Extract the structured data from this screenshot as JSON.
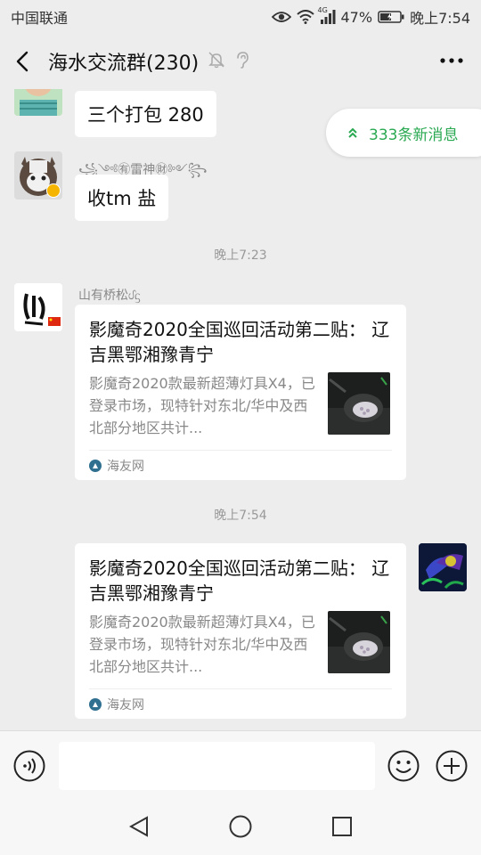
{
  "status_bar": {
    "carrier": "中国联通",
    "network": "4G",
    "battery": "47%",
    "time": "晚上7:54"
  },
  "header": {
    "title": "海水交流群(230)"
  },
  "new_messages": {
    "label": "333条新消息"
  },
  "messages": [
    {
      "type": "text",
      "text": "三个打包 280"
    },
    {
      "type": "text",
      "sender": "꧁༺㊒雷神㊖༻꧂",
      "text": "收tm 盐"
    },
    {
      "type": "time",
      "text": "晚上7:23"
    },
    {
      "type": "link",
      "sender": "山有桥松ᦔᦓ",
      "title": "影魔奇2020全国巡回活动第二贴： 辽吉黑鄂湘豫青宁",
      "desc": "影魔奇2020款最新超薄灯具X4，已登录市场，现特针对东北/华中及西北部分地区共计...",
      "source": "海友网"
    },
    {
      "type": "time",
      "text": "晚上7:54"
    },
    {
      "type": "link",
      "title": "影魔奇2020全国巡回活动第二贴： 辽吉黑鄂湘豫青宁",
      "desc": "影魔奇2020款最新超薄灯具X4，已登录市场，现特针对东北/华中及西北部分地区共计...",
      "source": "海友网"
    }
  ],
  "input": {
    "placeholder": ""
  }
}
